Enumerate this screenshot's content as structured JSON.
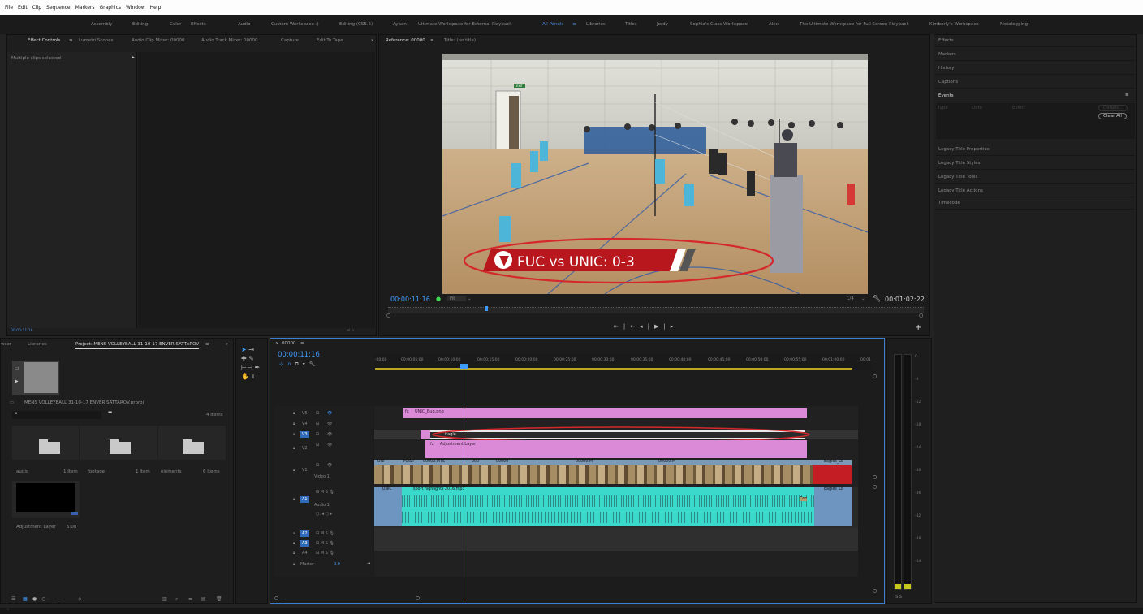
{
  "menu": [
    "File",
    "Edit",
    "Clip",
    "Sequence",
    "Markers",
    "Graphics",
    "Window",
    "Help"
  ],
  "workspaces": [
    "Assembly",
    "Editing",
    "Color",
    "Effects",
    "Audio",
    "Custom Workspace :)",
    "Editing (CS5.5)",
    "Ayaan",
    "Ultimate Workspace for External Playback",
    "All Panels",
    "Libraries",
    "Titles",
    "Jordy",
    "Sophia's Class Workspace",
    "Alex",
    "The Ultimate Workspace for Full Screen Playback",
    "Kimberly's Workspace",
    "Metalogging"
  ],
  "source_tabs": [
    "Effect Controls",
    "Lumetri Scopes",
    "Audio Clip Mixer: 00000",
    "Audio Track Mixer: 00000",
    "Capture",
    "Edit To Tape"
  ],
  "effect_controls": {
    "selection": "Multiple clips selected",
    "timecode": "00:00:11:16"
  },
  "program": {
    "tab_reference": "Reference: 00000",
    "tab_title": "Title: (no title)",
    "scoreboard": "FUC vs UNIC: 0-3",
    "exit_sign": "EXIT",
    "timecode": "00:00:11:16",
    "fit": "Fit",
    "quality": "1/4",
    "duration": "00:01:02:22"
  },
  "right_panels": [
    "Effects",
    "Markers",
    "History",
    "Captions",
    "Events",
    "Legacy Title Properties",
    "Legacy Title Styles",
    "Legacy Title Tools",
    "Legacy Title Actions",
    "Timecode"
  ],
  "events": {
    "headers": [
      "Type",
      "Date",
      "Event"
    ],
    "details_btn": "Details...",
    "clear_btn": "Clear All"
  },
  "project": {
    "tabs": [
      "wser",
      "Libraries",
      "Project: MENS VOLLEYBALL 31-10-17 ENVER SATTAROV"
    ],
    "file": "MENS VOLLEYBALL 31-10-17 ENVER SATTAROV.prproj",
    "count": "4 Items",
    "items": [
      {
        "name": "audio",
        "info": "1 Item"
      },
      {
        "name": "footage",
        "info": "1 Item"
      },
      {
        "name": "elements",
        "info": "6 Items"
      },
      {
        "name": "Adjustment Layer",
        "info": "5:00"
      }
    ]
  },
  "timeline": {
    "tab": "00000",
    "timecode": "00:00:11:16",
    "ruler": [
      ":00:00",
      "00:00:05:00",
      "00:00:10:00",
      "00:00:15:00",
      "00:00:20:00",
      "00:00:25:00",
      "00:00:30:00",
      "00:00:35:00",
      "00:00:40:00",
      "00:00:45:00",
      "00:00:50:00",
      "00:00:55:00",
      "00:01:00:00",
      "00:01"
    ],
    "video_tracks": [
      "V5",
      "V4",
      "V3",
      "V2",
      "V1"
    ],
    "audio_tracks": [
      "A1",
      "A2",
      "A3",
      "A4"
    ],
    "v1_name": "Video 1",
    "a1_name": "Audio 1",
    "master": "Master",
    "master_val": "0.0",
    "clips": {
      "v5": "UNIC_Bug.png",
      "v3": "Eagle",
      "v2": "Adjustment Layer",
      "v1_a": "UNI",
      "v1_b": "MAST",
      "v1_c": "00000.MTS",
      "v1_d": "000",
      "v1_e": "00000",
      "v1_f": "00009.M",
      "v1_g": "00000.M",
      "v1_end": "Eagles_Lo",
      "a1_a": "UNIC",
      "a1_b": "sport highlights 2016.mp3",
      "a1_end": "Eagles_Lo",
      "a1_con": "Con"
    }
  },
  "meter_labels": [
    "0",
    "-6",
    "-12",
    "-18",
    "-24",
    "-30",
    "-36",
    "-42",
    "-48",
    "-54"
  ],
  "colors": {
    "accent": "#4d8fe6",
    "clip_pink": "#da8ad6",
    "clip_video": "#7a9ab8",
    "clip_audio": "#3bd9cc",
    "clip_red": "#c41e24",
    "circle": "#d4282d"
  }
}
